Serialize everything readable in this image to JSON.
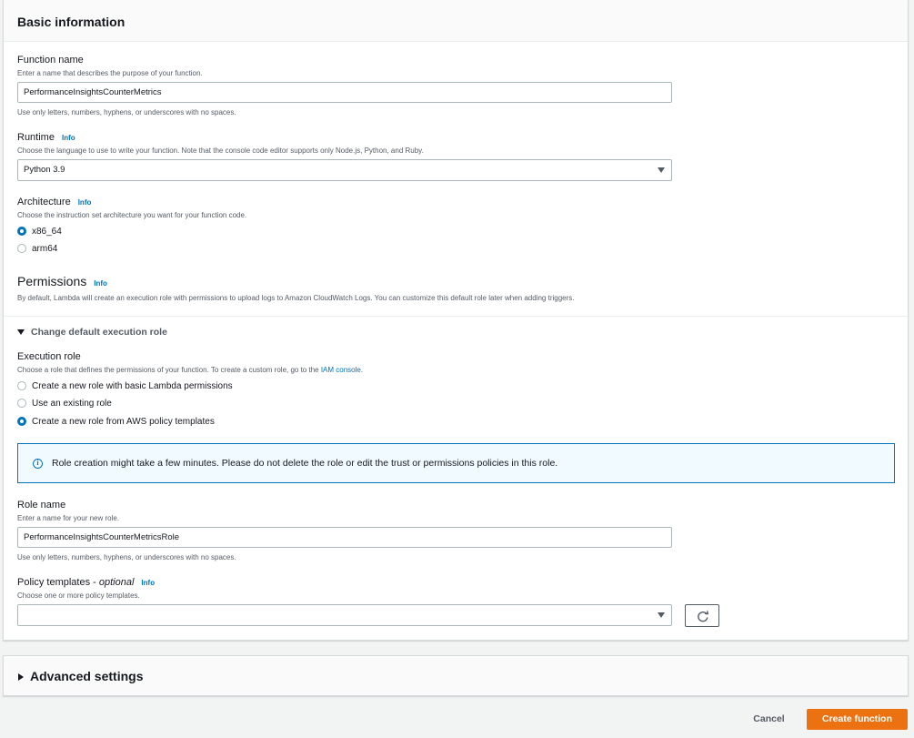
{
  "basic_info": {
    "title": "Basic information",
    "function_name": {
      "label": "Function name",
      "description": "Enter a name that describes the purpose of your function.",
      "value": "PerformanceInsightsCounterMetrics",
      "hint": "Use only letters, numbers, hyphens, or underscores with no spaces."
    },
    "runtime": {
      "label": "Runtime",
      "info": "Info",
      "description": "Choose the language to use to write your function. Note that the console code editor supports only Node.js, Python, and Ruby.",
      "value": "Python 3.9"
    },
    "architecture": {
      "label": "Architecture",
      "info": "Info",
      "description": "Choose the instruction set architecture you want for your function code.",
      "options": [
        "x86_64",
        "arm64"
      ],
      "selected": "x86_64"
    },
    "permissions": {
      "title": "Permissions",
      "info": "Info",
      "description": "By default, Lambda will create an execution role with permissions to upload logs to Amazon CloudWatch Logs. You can customize this default role later when adding triggers."
    },
    "change_role": {
      "label": "Change default execution role",
      "execution_role": {
        "label": "Execution role",
        "description_prefix": "Choose a role that defines the permissions of your function. To create a custom role, go to the ",
        "link": "IAM console",
        "description_suffix": ".",
        "options": [
          "Create a new role with basic Lambda permissions",
          "Use an existing role",
          "Create a new role from AWS policy templates"
        ],
        "selected": "Create a new role from AWS policy templates"
      },
      "alert": "Role creation might take a few minutes. Please do not delete the role or edit the trust or permissions policies in this role.",
      "role_name": {
        "label": "Role name",
        "description": "Enter a name for your new role.",
        "value": "PerformanceInsightsCounterMetricsRole",
        "hint": "Use only letters, numbers, hyphens, or underscores with no spaces."
      },
      "policy_templates": {
        "label": "Policy templates - ",
        "optional": "optional",
        "info": "Info",
        "description": "Choose one or more policy templates.",
        "value": ""
      }
    }
  },
  "advanced": {
    "title": "Advanced settings"
  },
  "footer": {
    "cancel": "Cancel",
    "create": "Create function"
  },
  "colors": {
    "accent": "#0073bb",
    "primary_button": "#ec7211",
    "text": "#16191f",
    "muted": "#545b64"
  }
}
